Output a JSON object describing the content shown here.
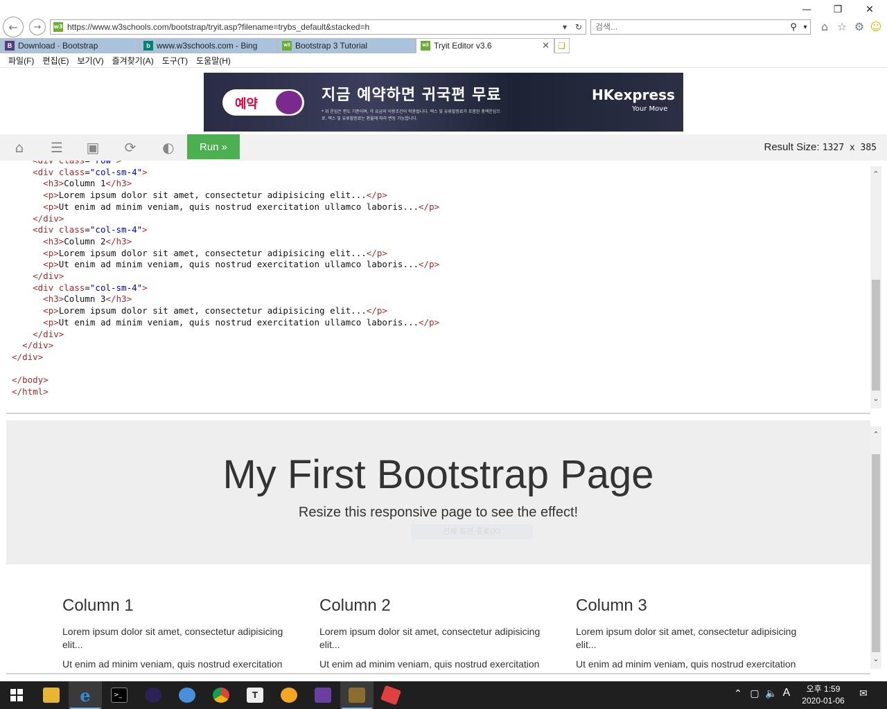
{
  "browser": {
    "url": "https://www.w3schools.com/bootstrap/tryit.asp?filename=trybs_default&stacked=h",
    "search_placeholder": "검색...",
    "tabs": [
      {
        "label": "Download · Bootstrap",
        "icon": "B"
      },
      {
        "label": "www.w3schools.com - Bing",
        "icon": "b"
      },
      {
        "label": "Bootstrap 3 Tutorial",
        "icon": "w3"
      },
      {
        "label": "Tryit Editor v3.6",
        "icon": "w3"
      }
    ],
    "menu": [
      "파일(F)",
      "편집(E)",
      "보기(V)",
      "즐겨찾기(A)",
      "도구(T)",
      "도움말(H)"
    ]
  },
  "ad": {
    "button": "예약",
    "headline": "지금 예약하면 귀국편 무료",
    "fine_print": "* 위 운임은 편도 기준이며, 각 요금의 이용조건이 적용됩니다. 텍스 및 유류할증료가 포함된 총액운임으로, 텍스 및 유류할증료는 환율에 따라 변동 가능합니다.",
    "brand": "HKexpress",
    "tagline": "Your Move"
  },
  "toolbar": {
    "run_label": "Run »",
    "result_size_label": "Result Size:",
    "result_size_value": "1327 x 385"
  },
  "result": {
    "title": "My First Bootstrap Page",
    "subtitle": "Resize this responsive page to see the effect!",
    "ghost_text": "전체 화면 종료(K)",
    "columns": [
      {
        "heading": "Column 1",
        "p1": "Lorem ipsum dolor sit amet, consectetur adipisicing elit...",
        "p2": "Ut enim ad minim veniam, quis nostrud exercitation ullamco laboris..."
      },
      {
        "heading": "Column 2",
        "p1": "Lorem ipsum dolor sit amet, consectetur adipisicing elit...",
        "p2": "Ut enim ad minim veniam, quis nostrud exercitation ullamco laboris..."
      },
      {
        "heading": "Column 3",
        "p1": "Lorem ipsum dolor sit amet, consectetur adipisicing elit...",
        "p2": "Ut enim ad minim veniam, quis nostrud exercitation ullamco laboris..."
      }
    ]
  },
  "taskbar": {
    "time": "오후 1:59",
    "date": "2020-01-06",
    "ime": "A"
  },
  "colors": {
    "run_green": "#4CAF50",
    "tab_inactive": "#a9c3dd",
    "code_tag": "#a52a2a",
    "code_attr_value": "#0000cd"
  },
  "code_lines": [
    [
      [
        "    ",
        "tx"
      ],
      [
        "<",
        "tg"
      ],
      [
        "div",
        " tg"
      ],
      [
        " class",
        "at"
      ],
      [
        "=",
        "tx"
      ],
      [
        "\"row\"",
        "av"
      ],
      [
        ">",
        "tg"
      ]
    ],
    [
      [
        "    ",
        "tx"
      ],
      [
        "<",
        "tg"
      ],
      [
        "div",
        "tg"
      ],
      [
        " class",
        "at"
      ],
      [
        "=",
        "tx"
      ],
      [
        "\"col-sm-4\"",
        "av"
      ],
      [
        ">",
        "tg"
      ]
    ],
    [
      [
        "      ",
        "tx"
      ],
      [
        "<",
        "tg"
      ],
      [
        "h3",
        "tg"
      ],
      [
        ">",
        "tg"
      ],
      [
        "Column 1",
        "tx"
      ],
      [
        "</",
        "tg"
      ],
      [
        "h3",
        "tg"
      ],
      [
        ">",
        "tg"
      ]
    ],
    [
      [
        "      ",
        "tx"
      ],
      [
        "<",
        "tg"
      ],
      [
        "p",
        "tg"
      ],
      [
        ">",
        "tg"
      ],
      [
        "Lorem ipsum dolor sit amet, consectetur adipisicing elit...",
        "tx"
      ],
      [
        "</",
        "tg"
      ],
      [
        "p",
        "tg"
      ],
      [
        ">",
        "tg"
      ]
    ],
    [
      [
        "      ",
        "tx"
      ],
      [
        "<",
        "tg"
      ],
      [
        "p",
        "tg"
      ],
      [
        ">",
        "tg"
      ],
      [
        "Ut enim ad minim veniam, quis nostrud exercitation ullamco laboris...",
        "tx"
      ],
      [
        "</",
        "tg"
      ],
      [
        "p",
        "tg"
      ],
      [
        ">",
        "tg"
      ]
    ],
    [
      [
        "    ",
        "tx"
      ],
      [
        "</",
        "tg"
      ],
      [
        "div",
        "tg"
      ],
      [
        ">",
        "tg"
      ]
    ],
    [
      [
        "    ",
        "tx"
      ],
      [
        "<",
        "tg"
      ],
      [
        "div",
        "tg"
      ],
      [
        " class",
        "at"
      ],
      [
        "=",
        "tx"
      ],
      [
        "\"col-sm-4\"",
        "av"
      ],
      [
        ">",
        "tg"
      ]
    ],
    [
      [
        "      ",
        "tx"
      ],
      [
        "<",
        "tg"
      ],
      [
        "h3",
        "tg"
      ],
      [
        ">",
        "tg"
      ],
      [
        "Column 2",
        "tx"
      ],
      [
        "</",
        "tg"
      ],
      [
        "h3",
        "tg"
      ],
      [
        ">",
        "tg"
      ]
    ],
    [
      [
        "      ",
        "tx"
      ],
      [
        "<",
        "tg"
      ],
      [
        "p",
        "tg"
      ],
      [
        ">",
        "tg"
      ],
      [
        "Lorem ipsum dolor sit amet, consectetur adipisicing elit...",
        "tx"
      ],
      [
        "</",
        "tg"
      ],
      [
        "p",
        "tg"
      ],
      [
        ">",
        "tg"
      ]
    ],
    [
      [
        "      ",
        "tx"
      ],
      [
        "<",
        "tg"
      ],
      [
        "p",
        "tg"
      ],
      [
        ">",
        "tg"
      ],
      [
        "Ut enim ad minim veniam, quis nostrud exercitation ullamco laboris...",
        "tx"
      ],
      [
        "</",
        "tg"
      ],
      [
        "p",
        "tg"
      ],
      [
        ">",
        "tg"
      ]
    ],
    [
      [
        "    ",
        "tx"
      ],
      [
        "</",
        "tg"
      ],
      [
        "div",
        "tg"
      ],
      [
        ">",
        "tg"
      ]
    ],
    [
      [
        "    ",
        "tx"
      ],
      [
        "<",
        "tg"
      ],
      [
        "div",
        "tg"
      ],
      [
        " class",
        "at"
      ],
      [
        "=",
        "tx"
      ],
      [
        "\"col-sm-4\"",
        "av"
      ],
      [
        ">",
        "tg"
      ]
    ],
    [
      [
        "      ",
        "tx"
      ],
      [
        "<",
        "tg"
      ],
      [
        "h3",
        "tg"
      ],
      [
        ">",
        "tg"
      ],
      [
        "Column 3",
        "tx"
      ],
      [
        "</",
        "tg"
      ],
      [
        "h3",
        "tg"
      ],
      [
        ">",
        "tg"
      ]
    ],
    [
      [
        "      ",
        "tx"
      ],
      [
        "<",
        "tg"
      ],
      [
        "p",
        "tg"
      ],
      [
        ">",
        "tg"
      ],
      [
        "Lorem ipsum dolor sit amet, consectetur adipisicing elit...",
        "tx"
      ],
      [
        "</",
        "tg"
      ],
      [
        "p",
        "tg"
      ],
      [
        ">",
        "tg"
      ]
    ],
    [
      [
        "      ",
        "tx"
      ],
      [
        "<",
        "tg"
      ],
      [
        "p",
        "tg"
      ],
      [
        ">",
        "tg"
      ],
      [
        "Ut enim ad minim veniam, quis nostrud exercitation ullamco laboris...",
        "tx"
      ],
      [
        "</",
        "tg"
      ],
      [
        "p",
        "tg"
      ],
      [
        ">",
        "tg"
      ]
    ],
    [
      [
        "    ",
        "tx"
      ],
      [
        "</",
        "tg"
      ],
      [
        "div",
        "tg"
      ],
      [
        ">",
        "tg"
      ]
    ],
    [
      [
        "  ",
        "tx"
      ],
      [
        "</",
        "tg"
      ],
      [
        "div",
        "tg"
      ],
      [
        ">",
        "tg"
      ]
    ],
    [
      [
        "",
        "tx"
      ],
      [
        "</",
        "tg"
      ],
      [
        "div",
        "tg"
      ],
      [
        ">",
        "tg"
      ]
    ],
    [
      [
        "",
        "tx"
      ]
    ],
    [
      [
        "",
        "tx"
      ],
      [
        "</",
        "tg"
      ],
      [
        "body",
        "tg"
      ],
      [
        ">",
        "tg"
      ]
    ],
    [
      [
        "",
        "tx"
      ],
      [
        "</",
        "tg"
      ],
      [
        "html",
        "tg"
      ],
      [
        ">",
        "tg"
      ]
    ]
  ]
}
